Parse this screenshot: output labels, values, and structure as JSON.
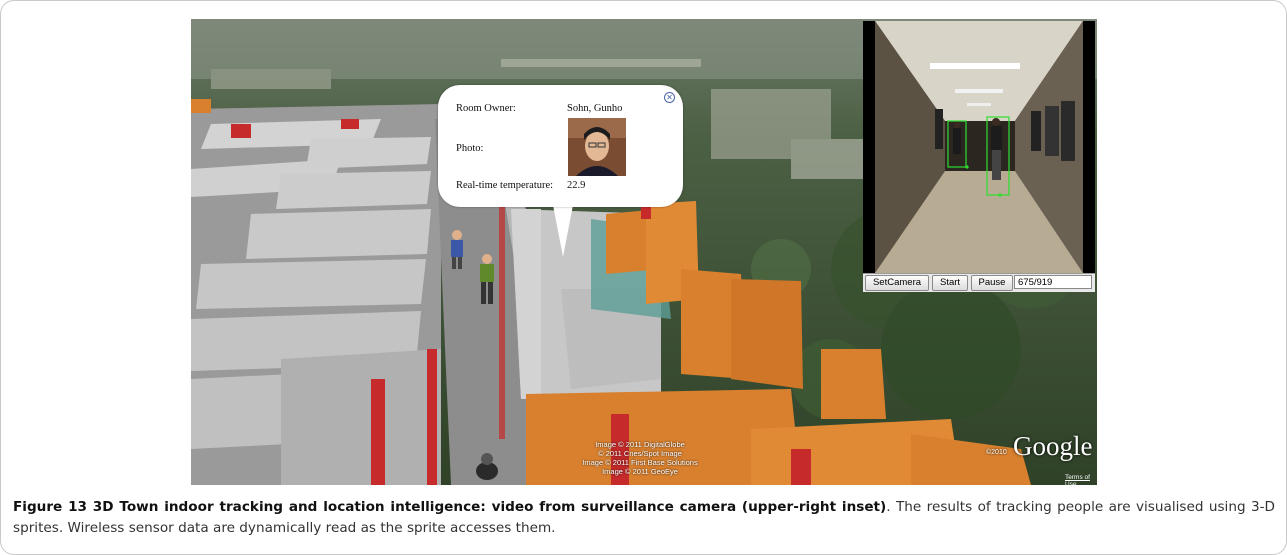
{
  "balloon": {
    "room_owner_label": "Room Owner:",
    "room_owner_value": "Sohn, Gunho",
    "photo_label": "Photo:",
    "temperature_label": "Real-time temperature:",
    "temperature_value": "22.9",
    "close_icon": "close-icon"
  },
  "video_controls": {
    "set_camera": "SetCamera",
    "start": "Start",
    "pause": "Pause",
    "frame_counter": "675/919"
  },
  "map_attribution": {
    "line1": "Image © 2011 DigitalGlobe",
    "line2": "© 2011 Cnes/Spot Image",
    "line3": "Image © 2011 First Base Solutions",
    "line4": "Image © 2011 GeoEye",
    "google_year": "©2010",
    "google_logo": "Google",
    "terms": "Terms of Use"
  },
  "caption": {
    "figure_title": "Figure 13 3D Town indoor tracking and location intelligence: video from surveillance camera (upper-right inset)",
    "body": ". The results of tracking people are visualised using 3-D sprites. Wireless sensor data are dynamically read as the sprite accesses them."
  },
  "colors": {
    "wall_orange": "#d9802e",
    "wall_grey": "#c8c8c8",
    "wall_red": "#c62a2a",
    "corridor": "#8c8c8c"
  }
}
